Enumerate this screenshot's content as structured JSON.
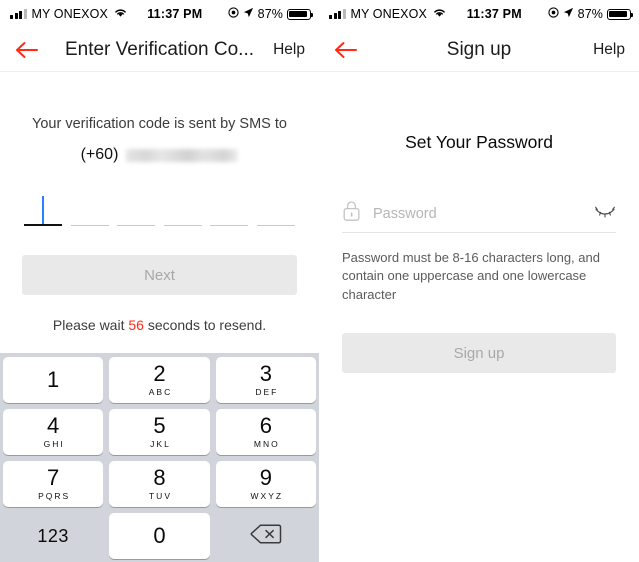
{
  "status_bar": {
    "carrier": "MY ONEXOX",
    "wifi_icon": "wifi-icon",
    "time": "11:37 PM",
    "do_not_disturb_icon": "do-not-disturb-icon",
    "location_icon": "location-arrow-icon",
    "battery_percent": "87%",
    "battery_icon": "battery-icon"
  },
  "left_screen": {
    "nav": {
      "back_icon": "back-arrow-icon",
      "title": "Enter Verification Co...",
      "help_label": "Help"
    },
    "sms_text": "Your verification code is sent by SMS to",
    "country_code": "(+60)",
    "phone_number_masked": "",
    "otp": {
      "slot_count": 6,
      "active_index": 0,
      "values": [
        "",
        "",
        "",
        "",
        "",
        ""
      ]
    },
    "next_button": "Next",
    "resend": {
      "prefix": "Please wait ",
      "seconds": "56",
      "suffix": " seconds to resend."
    },
    "keypad": {
      "keys": [
        {
          "digit": "1",
          "letters": ""
        },
        {
          "digit": "2",
          "letters": "ABC"
        },
        {
          "digit": "3",
          "letters": "DEF"
        },
        {
          "digit": "4",
          "letters": "GHI"
        },
        {
          "digit": "5",
          "letters": "JKL"
        },
        {
          "digit": "6",
          "letters": "MNO"
        },
        {
          "digit": "7",
          "letters": "PQRS"
        },
        {
          "digit": "8",
          "letters": "TUV"
        },
        {
          "digit": "9",
          "letters": "WXYZ"
        }
      ],
      "switch_label": "123",
      "zero": "0",
      "backspace_icon": "backspace-icon"
    }
  },
  "right_screen": {
    "nav": {
      "back_icon": "back-arrow-icon",
      "title": "Sign up",
      "help_label": "Help"
    },
    "heading": "Set Your Password",
    "password_field": {
      "lock_icon": "lock-icon",
      "value": "",
      "placeholder": "Password",
      "visibility_icon": "eye-slash-icon"
    },
    "hint": "Password must be 8-16 characters long, and contain one uppercase and one lowercase character",
    "signup_button": "Sign up"
  },
  "colors": {
    "accent_red": "#ff2b16",
    "caret_blue": "#2b7fff",
    "disabled_button_bg": "#e9e9e9",
    "disabled_button_text": "#a8a8a8",
    "keypad_bg": "#d1d5db"
  }
}
